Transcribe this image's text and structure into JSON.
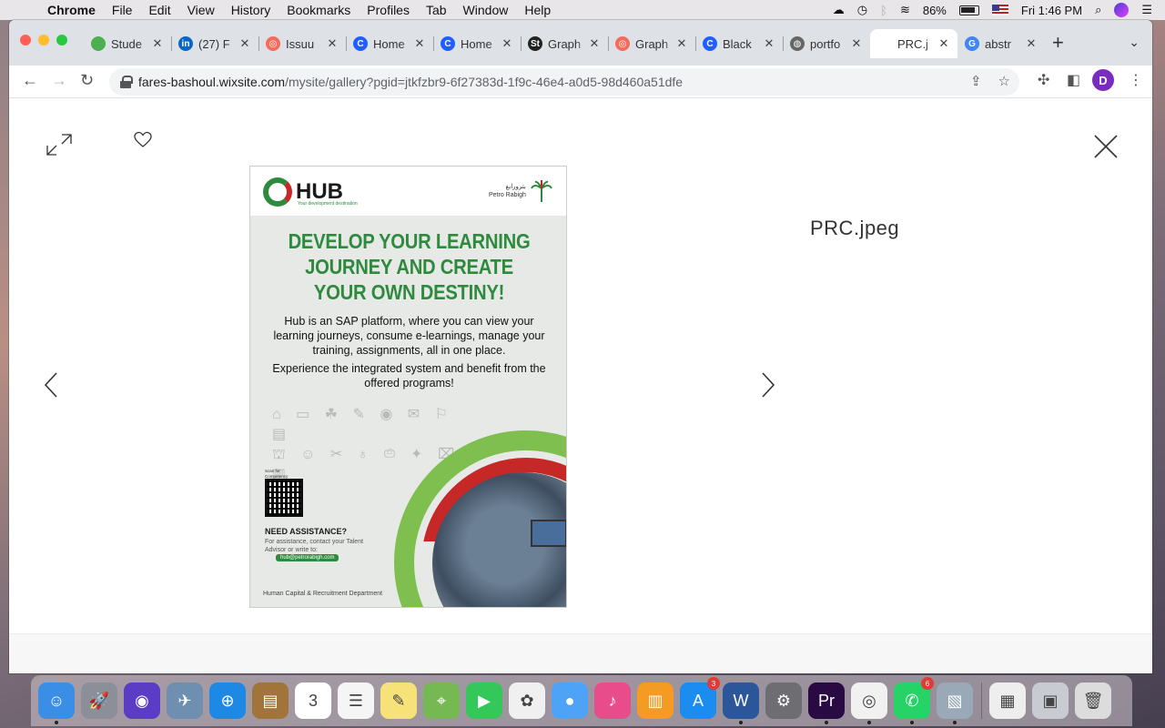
{
  "menubar": {
    "app_name": "Chrome",
    "menus": [
      "File",
      "Edit",
      "View",
      "History",
      "Bookmarks",
      "Profiles",
      "Tab",
      "Window",
      "Help"
    ],
    "battery_percent": "86%",
    "clock": "Fri 1:46 PM"
  },
  "tabs": [
    {
      "title": "Stude",
      "favicon_color": "#4caf50",
      "favicon_glyph": ""
    },
    {
      "title": "(27) F",
      "favicon_color": "#0a66c2",
      "favicon_glyph": "in"
    },
    {
      "title": "Issuu",
      "favicon_color": "#f36d5d",
      "favicon_glyph": "◎"
    },
    {
      "title": "Home",
      "favicon_color": "#1f5fff",
      "favicon_glyph": "C"
    },
    {
      "title": "Home",
      "favicon_color": "#1f5fff",
      "favicon_glyph": "C"
    },
    {
      "title": "Graph",
      "favicon_color": "#222222",
      "favicon_glyph": "St"
    },
    {
      "title": "Graph",
      "favicon_color": "#f36d5d",
      "favicon_glyph": "◎"
    },
    {
      "title": "Black",
      "favicon_color": "#1f5fff",
      "favicon_glyph": "C"
    },
    {
      "title": "portfo",
      "favicon_color": "#666666",
      "favicon_glyph": "◍"
    },
    {
      "title": "PRC.j",
      "favicon_color": "#ffffff",
      "favicon_glyph": ""
    },
    {
      "title": "abstr",
      "favicon_color": "#4285f4",
      "favicon_glyph": "G"
    }
  ],
  "active_tab_index": 9,
  "address_bar": {
    "domain": "fares-bashoul.wixsite.com",
    "path": "/mysite/gallery?pgid=jtkfzbr9-6f27383d-1f9c-46e4-a0d5-98d460a51dfe"
  },
  "profile_initial": "D",
  "gallery": {
    "file_title": "PRC.jpeg"
  },
  "poster": {
    "brand": "HUB",
    "brand_tagline": "Your development destination",
    "partner_arabic": "بترورابغ",
    "partner_name": "Petro Rabigh",
    "headline": [
      "DEVELOP YOUR LEARNING",
      "JOURNEY AND CREATE",
      "YOUR OWN DESTINY!"
    ],
    "body1": "Hub is an SAP platform, where you can view your learning journeys, consume e-learnings, manage your training, assignments, all in one place.",
    "body2": "Experience the integrated system and benefit from the offered programs!",
    "qr_caption": "Scan for Competency booklet",
    "need_title": "NEED ASSISTANCE?",
    "need_text": "For assistance, contact your Talent Advisor or write to:",
    "email": "hub@petrorabigh.com",
    "footer": "Human Capital & Recruitment Department",
    "accent_green": "#2e8b3e",
    "accent_red": "#c62828"
  },
  "dock": [
    {
      "name": "Finder",
      "color": "#3a8ee6",
      "glyph": "☺",
      "running": true
    },
    {
      "name": "Launchpad",
      "color": "#8a8f9a",
      "glyph": "🚀",
      "running": false
    },
    {
      "name": "Siri",
      "color": "#5b3cc4",
      "glyph": "◉",
      "running": false
    },
    {
      "name": "Image Capture",
      "color": "#6f8fb0",
      "glyph": "✈",
      "running": false
    },
    {
      "name": "Safari",
      "color": "#1e88e5",
      "glyph": "⊕",
      "running": false
    },
    {
      "name": "Notefile",
      "color": "#a0743a",
      "glyph": "▤",
      "running": false
    },
    {
      "name": "Calendar",
      "color": "#ffffff",
      "glyph": "3",
      "running": false
    },
    {
      "name": "Reminders",
      "color": "#f5f5f5",
      "glyph": "☰",
      "running": false
    },
    {
      "name": "Notes",
      "color": "#f7e27a",
      "glyph": "✎",
      "running": false
    },
    {
      "name": "Maps",
      "color": "#76b852",
      "glyph": "⌖",
      "running": false
    },
    {
      "name": "FaceTime",
      "color": "#34c759",
      "glyph": "▶",
      "running": false
    },
    {
      "name": "Photos",
      "color": "#f0f0f0",
      "glyph": "✿",
      "running": false
    },
    {
      "name": "Messages",
      "color": "#4fa3f7",
      "glyph": "●",
      "running": false
    },
    {
      "name": "iTunes",
      "color": "#e94c8b",
      "glyph": "♪",
      "running": false
    },
    {
      "name": "Books",
      "color": "#f59a23",
      "glyph": "▥",
      "running": false
    },
    {
      "name": "App Store",
      "color": "#1b8cf0",
      "glyph": "A",
      "running": false,
      "badge": "3"
    },
    {
      "name": "Word",
      "color": "#2b579a",
      "glyph": "W",
      "running": true
    },
    {
      "name": "System Preferences",
      "color": "#6d6d72",
      "glyph": "⚙",
      "running": false
    },
    {
      "name": "Premiere Pro",
      "color": "#2a0a42",
      "glyph": "Pr",
      "running": true
    },
    {
      "name": "Chrome",
      "color": "#f1f1f1",
      "glyph": "◎",
      "running": true
    },
    {
      "name": "WhatsApp",
      "color": "#25d366",
      "glyph": "✆",
      "running": true,
      "badge": "6"
    },
    {
      "name": "Preview",
      "color": "#9aa9b8",
      "glyph": "▧",
      "running": true
    },
    {
      "name": "Document",
      "color": "#eeeeee",
      "glyph": "▦",
      "running": false
    },
    {
      "name": "Downloads",
      "color": "#c8ccd2",
      "glyph": "▣",
      "running": false
    },
    {
      "name": "Trash",
      "color": "#dcdcdc",
      "glyph": "🗑",
      "running": false
    }
  ]
}
